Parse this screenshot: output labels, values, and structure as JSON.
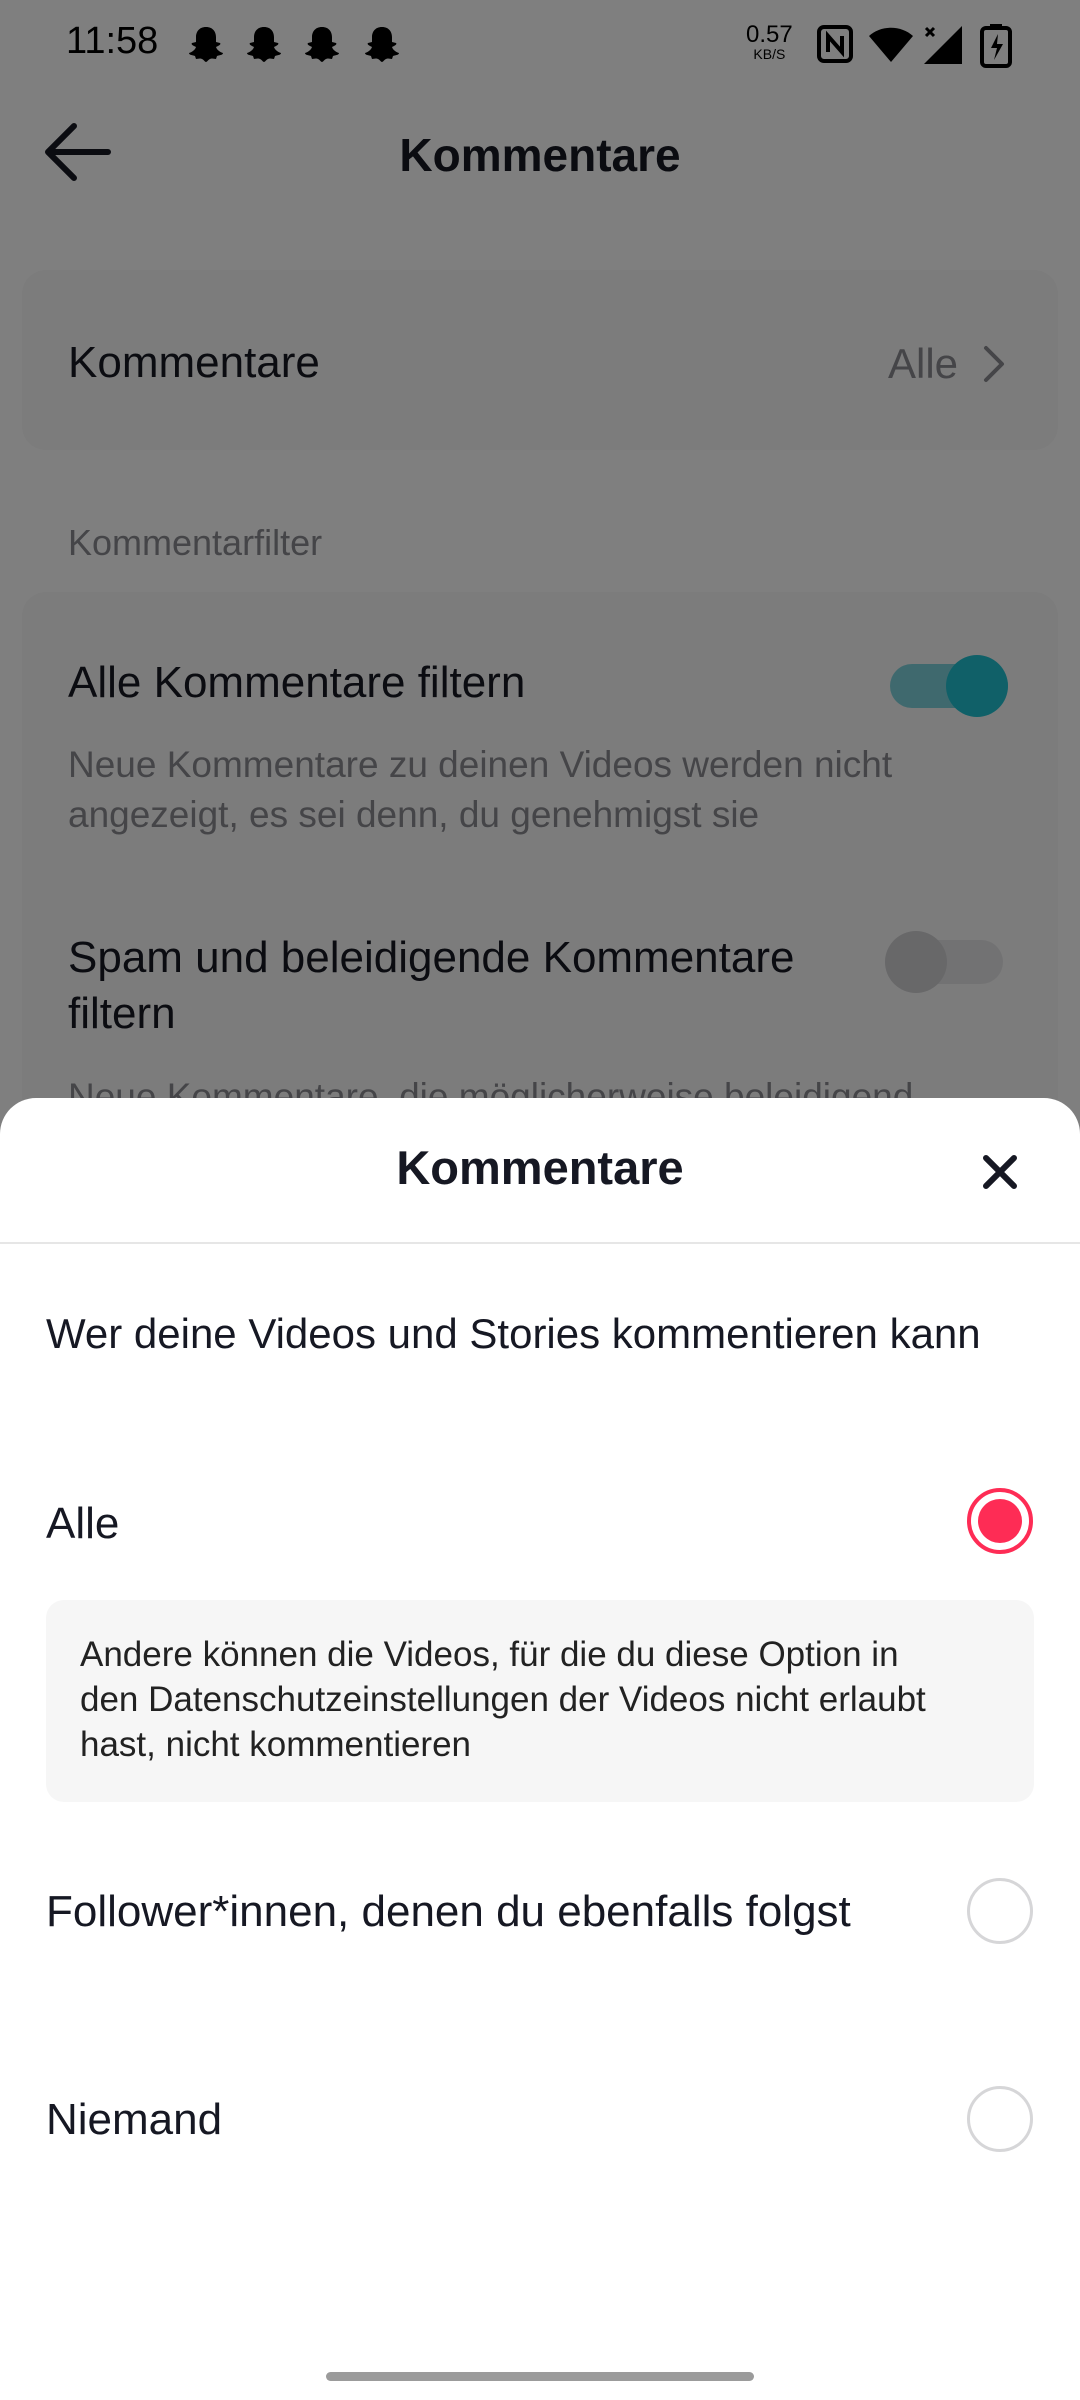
{
  "status_bar": {
    "time": "11:58",
    "net_speed": "0.57",
    "net_unit": "KB/S",
    "notification_icons": [
      "snapchat-icon",
      "snapchat-icon",
      "snapchat-icon",
      "snapchat-icon"
    ],
    "system_icons": [
      "nfc-icon",
      "wifi-icon",
      "signal-icon",
      "battery-charging-icon"
    ]
  },
  "header": {
    "title": "Kommentare",
    "back_icon": "arrow-left-icon"
  },
  "settings": {
    "comments_row": {
      "label": "Kommentare",
      "value": "Alle"
    },
    "filter_section_label": "Kommentarfilter",
    "filter_all": {
      "title": "Alle Kommentare filtern",
      "description": "Neue Kommentare zu deinen Videos werden nicht angezeigt, es sei denn, du genehmigst sie",
      "enabled": true
    },
    "filter_spam": {
      "title": "Spam und beleidigende Kommentare filtern",
      "description": "Neue Kommentare, die möglicherweise beleidigend",
      "enabled": false
    }
  },
  "sheet": {
    "title": "Kommentare",
    "question": "Wer deine Videos und Stories kommentieren kann",
    "options": [
      {
        "label": "Alle",
        "selected": true
      },
      {
        "label": "Follower*innen, denen du ebenfalls folgst",
        "selected": false
      },
      {
        "label": "Niemand",
        "selected": false
      }
    ],
    "info": "Andere können die Videos, für die du diese Option in den Datenschutzeinstellungen der Videos nicht erlaubt hast, nicht kommentieren"
  },
  "colors": {
    "accent_selected": "#fe2c55",
    "toggle_on": "#20c0d0",
    "overlay": "rgba(0,0,0,0.5)"
  }
}
